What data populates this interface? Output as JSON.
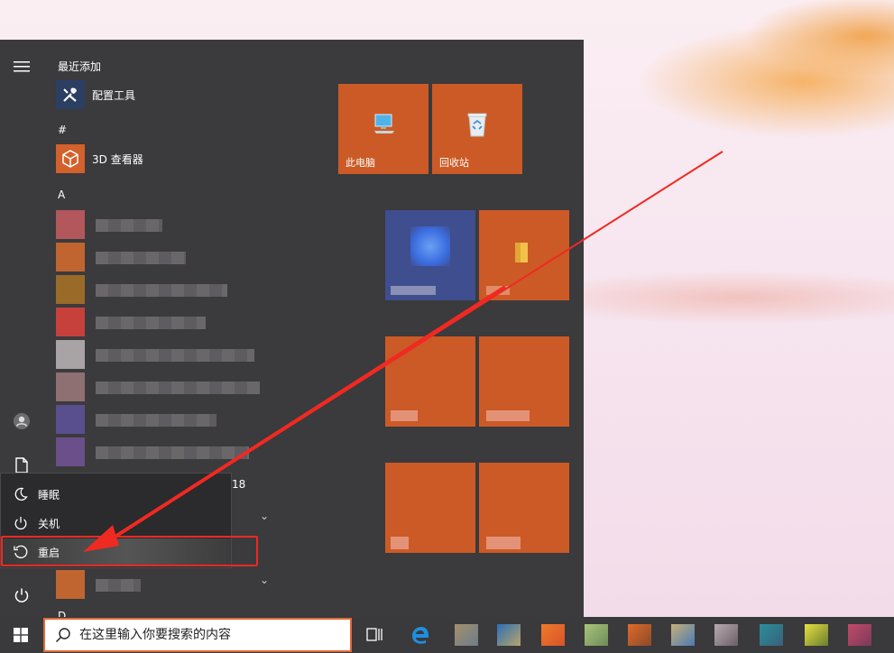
{
  "start_menu": {
    "recent_header": "最近添加",
    "recent_app_label": "配置工具",
    "hash_header": "#",
    "viewer_label": "3D 查看器",
    "a_header": "A",
    "partial_b_text": "18",
    "d_header": "D"
  },
  "tiles": {
    "this_pc_label": "此电脑",
    "recycle_bin_label": "回收站"
  },
  "power_menu": {
    "sleep_label": "睡眠",
    "shutdown_label": "关机",
    "restart_label": "重启"
  },
  "taskbar": {
    "search_placeholder": "在这里输入你要搜索的内容"
  },
  "colors": {
    "accent": "#cc5a26",
    "menu_bg": "#3b3a3c",
    "annotation_red": "#ef2a22"
  },
  "icons": {
    "menu": "hamburger-icon",
    "user": "user-icon",
    "documents": "document-icon",
    "power": "power-icon",
    "sleep": "moon-icon",
    "restart": "restart-icon",
    "start": "windows-icon",
    "search": "search-icon"
  }
}
